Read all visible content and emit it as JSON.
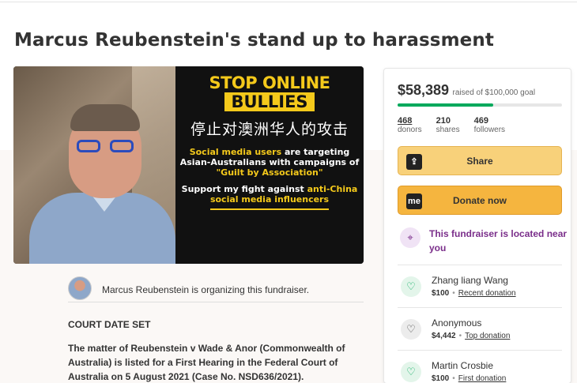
{
  "title": "Marcus Reubenstein's stand up to harassment",
  "hero": {
    "line1": "STOP ONLINE",
    "line2": "BULLIES",
    "chinese": "停止对澳洲华人的攻击",
    "p1_a": "Social media users",
    "p1_b": " are targeting Asian-Australians with campaigns of ",
    "p1_c": "\"Guilt by Association\"",
    "p2_a": "Support my fight against ",
    "p2_b": "anti-China social media influencers"
  },
  "organizer": {
    "text": "Marcus Reubenstein is organizing this fundraiser."
  },
  "story": {
    "heading": "COURT DATE SET",
    "body": "The matter of Reubenstein v Wade & Anor (Commonwealth of Australia) is listed for a First Hearing in the Federal Court of Australia on 5 August 2021 (Case No. NSD636/2021)."
  },
  "sidebar": {
    "amount": "$58,389",
    "goal_text": "raised of $100,000 goal",
    "progress": 0.58,
    "stats": [
      {
        "value": "468",
        "label": "donors"
      },
      {
        "value": "210",
        "label": "shares"
      },
      {
        "value": "469",
        "label": "followers"
      }
    ],
    "share_label": "Share",
    "donate_label": "Donate now",
    "donate_icon_text": "me",
    "location_text": "This fundraiser is located near you",
    "donations": [
      {
        "name": "Zhang liang Wang",
        "amount": "$100",
        "tag": "Recent donation",
        "icon": "green"
      },
      {
        "name": "Anonymous",
        "amount": "$4,442",
        "tag": "Top donation",
        "icon": "grey"
      },
      {
        "name": "Martin Crosbie",
        "amount": "$100",
        "tag": "First donation",
        "icon": "green"
      }
    ]
  },
  "colors": {
    "accent": "#02a95c",
    "share": "#f8d17a",
    "donate": "#f5b53f",
    "location": "#7a2e8a"
  }
}
